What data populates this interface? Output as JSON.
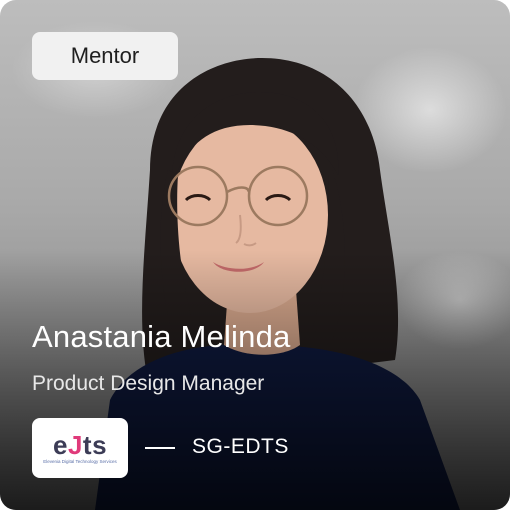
{
  "card": {
    "badge": "Mentor",
    "name": "Anastania Melinda",
    "role": "Product Design Manager",
    "company": "SG-EDTS",
    "logo": {
      "mark_e": "e",
      "mark_j": "J",
      "mark_ts": "ts",
      "tagline": "Elevenia Digital Technology Services"
    }
  },
  "colors": {
    "badge_bg": "#f1f1f1",
    "text_light": "#ffffff",
    "logo_accent": "#e03a7a",
    "sweater": "#0f1a3f"
  }
}
